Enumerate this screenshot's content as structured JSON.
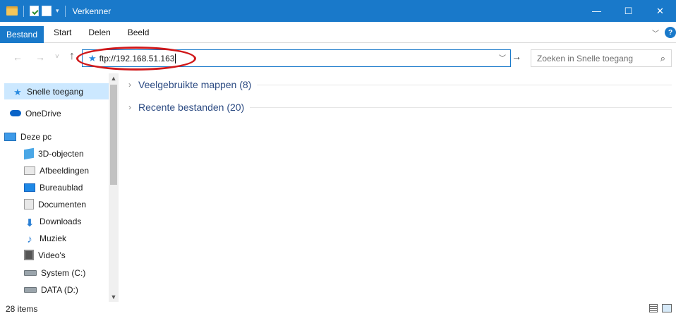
{
  "window": {
    "title": "Verkenner",
    "controls": {
      "minimize": "—",
      "maximize": "☐",
      "close": "✕"
    }
  },
  "ribbon": {
    "tabs": [
      "Bestand",
      "Start",
      "Delen",
      "Beeld"
    ],
    "help": "?"
  },
  "address": {
    "value": "ftp://192.168.51.163",
    "search_placeholder": "Zoeken in Snelle toegang"
  },
  "nav": {
    "items": [
      {
        "label": "Snelle toegang",
        "icon": "quick-access-star-icon"
      },
      {
        "label": "OneDrive",
        "icon": "onedrive-cloud-icon"
      },
      {
        "label": "Deze pc",
        "icon": "this-pc-icon"
      },
      {
        "label": "3D-objecten",
        "icon": "3d-objects-icon"
      },
      {
        "label": "Afbeeldingen",
        "icon": "pictures-icon"
      },
      {
        "label": "Bureaublad",
        "icon": "desktop-icon"
      },
      {
        "label": "Documenten",
        "icon": "documents-icon"
      },
      {
        "label": "Downloads",
        "icon": "downloads-icon"
      },
      {
        "label": "Muziek",
        "icon": "music-icon"
      },
      {
        "label": "Video's",
        "icon": "videos-icon"
      },
      {
        "label": "System (C:)",
        "icon": "drive-icon"
      },
      {
        "label": "DATA (D:)",
        "icon": "drive-icon"
      }
    ]
  },
  "content": {
    "groups": [
      {
        "label": "Veelgebruikte mappen (8)"
      },
      {
        "label": "Recente bestanden (20)"
      }
    ]
  },
  "status": {
    "items": "28 items"
  },
  "colors": {
    "accent": "#1979ca",
    "selection": "#cce8ff",
    "annotation": "#d0181a"
  }
}
